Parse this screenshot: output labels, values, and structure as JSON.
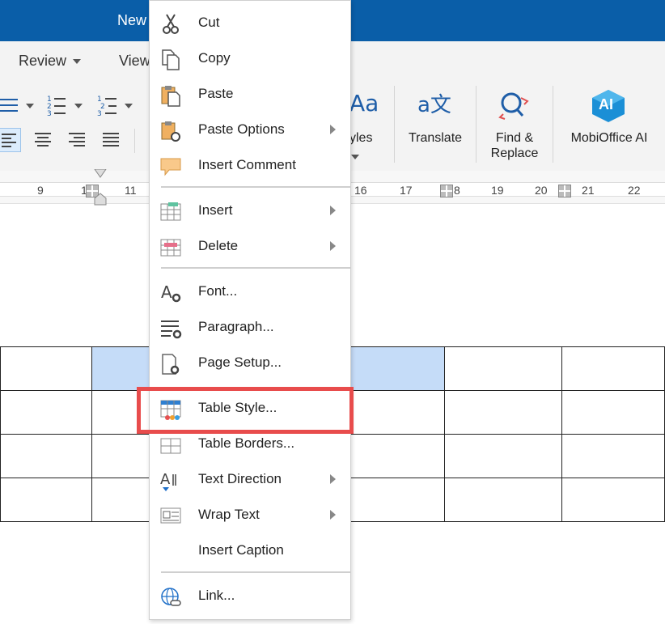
{
  "titlebar": {
    "title": "New"
  },
  "ribbon": {
    "tabs": [
      {
        "label": "Review"
      },
      {
        "label": "View"
      }
    ],
    "styles_label": "yles",
    "translate_label": "Translate",
    "find_replace_label_1": "Find &",
    "find_replace_label_2": "Replace",
    "mobioffice_ai_label": "MobiOffice AI",
    "ai_badge": "AI",
    "styles_glyph": "Aa",
    "translate_glyph": "a文"
  },
  "ruler": {
    "numbers": [
      "9",
      "1",
      "11",
      "16",
      "17",
      "8",
      "19",
      "20",
      "21",
      "22"
    ]
  },
  "context_menu": {
    "items": [
      {
        "label": "Cut",
        "icon": "scissors-icon"
      },
      {
        "label": "Copy",
        "icon": "copy-icon"
      },
      {
        "label": "Paste",
        "icon": "paste-icon"
      },
      {
        "label": "Paste Options",
        "icon": "paste-options-icon",
        "submenu": true
      },
      {
        "label": "Insert Comment",
        "icon": "comment-icon"
      },
      {
        "label": "Insert",
        "icon": "table-insert-icon",
        "submenu": true
      },
      {
        "label": "Delete",
        "icon": "table-delete-icon",
        "submenu": true
      },
      {
        "label": "Font...",
        "icon": "font-settings-icon"
      },
      {
        "label": "Paragraph...",
        "icon": "paragraph-settings-icon"
      },
      {
        "label": "Page Setup...",
        "icon": "page-setup-icon"
      },
      {
        "label": "Table Style...",
        "icon": "table-style-icon"
      },
      {
        "label": "Table Borders...",
        "icon": "table-borders-icon"
      },
      {
        "label": "Text Direction",
        "icon": "text-direction-icon",
        "submenu": true
      },
      {
        "label": "Wrap Text",
        "icon": "wrap-text-icon",
        "submenu": true
      },
      {
        "label": "Insert Caption",
        "icon": ""
      },
      {
        "label": "Link...",
        "icon": "link-icon"
      }
    ]
  },
  "colors": {
    "title_bar": "#0a5ea8",
    "highlight_border": "#e84c4c",
    "selected_cell": "#c5dcf8"
  }
}
